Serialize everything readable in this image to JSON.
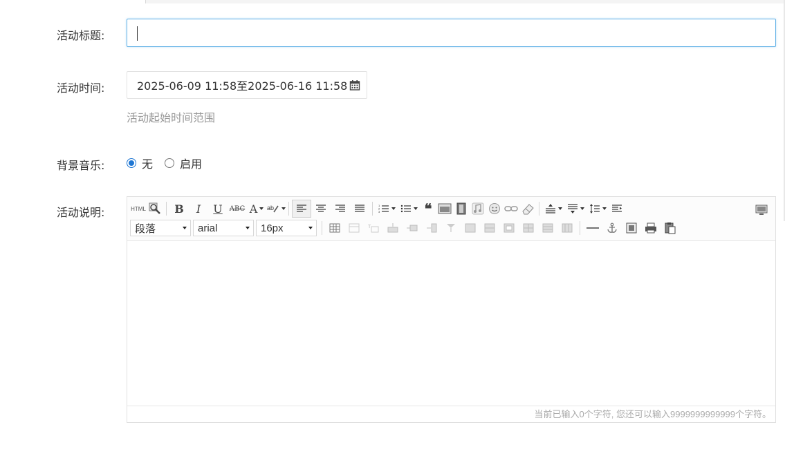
{
  "form": {
    "title_label": "活动标题:",
    "title_value": "",
    "time_label": "活动时间:",
    "time_value": "2025-06-09 11:58至2025-06-16 11:58",
    "time_hint": "活动起始时间范围",
    "music_label": "背景音乐:",
    "music_options": [
      {
        "label": "无",
        "selected": true
      },
      {
        "label": "启用",
        "selected": false
      }
    ],
    "desc_label": "活动说明:"
  },
  "editor": {
    "html_btn": "HTML",
    "paragraph_select": "段落",
    "font_select": "arial",
    "size_select": "16px",
    "bold": "B",
    "italic": "I",
    "underline": "U",
    "strike": "ABC",
    "fontcolor": "A",
    "status_text": "当前已输入0个字符, 您还可以输入9999999999999个字符。",
    "icons_row1": [
      "source-icon",
      "preview-icon",
      "bold-icon",
      "italic-icon",
      "underline-icon",
      "strikethrough-icon",
      "font-color-icon",
      "highlight-icon",
      "align-left-icon",
      "align-center-icon",
      "align-right-icon",
      "justify-icon",
      "ordered-list-icon",
      "unordered-list-icon",
      "blockquote-icon",
      "image-icon",
      "video-icon",
      "music-icon",
      "emoji-icon",
      "link-icon",
      "eraser-icon",
      "row-spacing-top-icon",
      "row-spacing-bottom-icon",
      "line-height-icon",
      "indent-icon",
      "fullscreen-icon"
    ],
    "icons_row2": [
      "table-icon",
      "table-props-icon",
      "insert-title-row-icon",
      "insert-row-icon",
      "delete-row-icon",
      "insert-col-icon",
      "delete-col-icon",
      "merge-cells-icon",
      "merge-right-icon",
      "merge-down-icon",
      "split-cells-icon",
      "split-rows-icon",
      "split-cols-icon",
      "horizontal-rule-icon",
      "anchor-icon",
      "insert-image-icon",
      "print-icon",
      "paste-icon"
    ]
  },
  "colors": {
    "accent": "#1e76d3",
    "focus_border": "#5fb0e6",
    "hint": "#999999"
  }
}
